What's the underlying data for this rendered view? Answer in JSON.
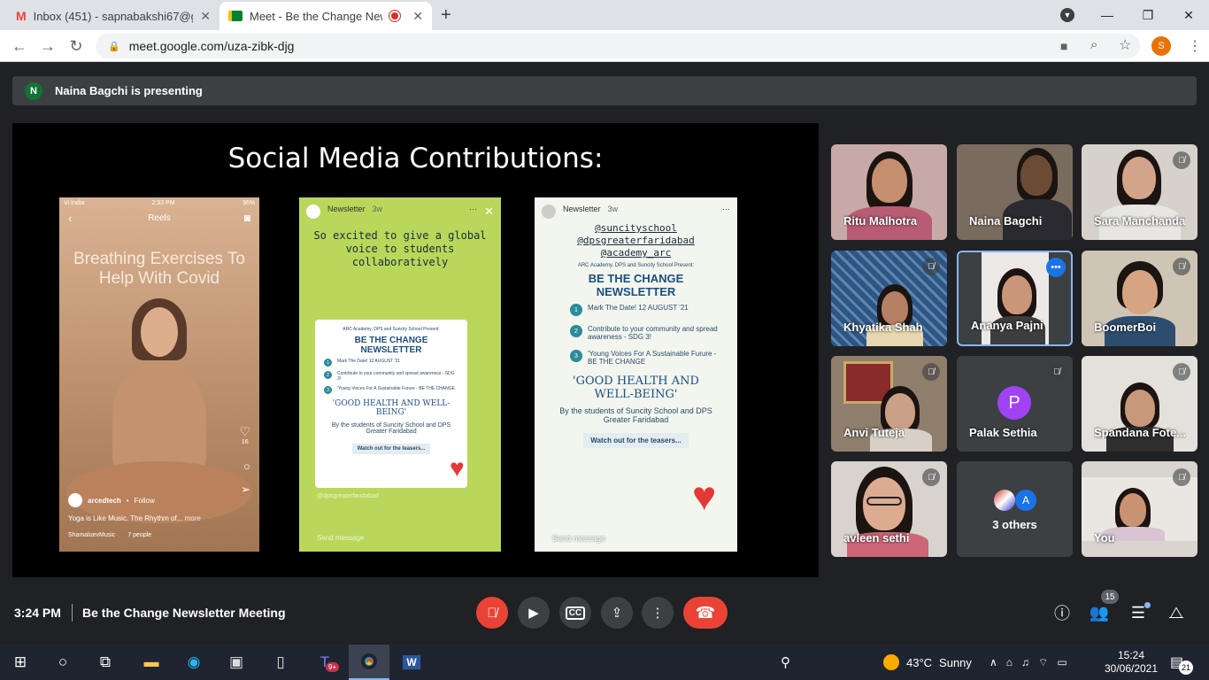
{
  "browser": {
    "tabs": [
      {
        "title": "Inbox (451) - sapnabakshi67@gm",
        "icon": "gmail-icon"
      },
      {
        "title": "Meet - Be the Change Newsl",
        "icon": "meet-icon"
      }
    ],
    "url": "meet.google.com/uza-zibk-djg",
    "profile_initial": "S",
    "profile_color": "#e8710a"
  },
  "meet": {
    "presenter_initial": "N",
    "presenting_text": "Naina Bagchi is presenting",
    "slide": {
      "title": "Social Media Contributions:",
      "reel": {
        "carrier": "Vi India",
        "time": "2:33 PM",
        "battery": "36%",
        "header": "Reels",
        "heading": "Breathing Exercises To Help With Covid",
        "likes": "16",
        "account": "arcedtech",
        "follow": "Follow",
        "caption": "Yoga is Like Music. The Rhythm of...",
        "more": "more",
        "music": "ShamaluevMusic",
        "people": "7 people"
      },
      "story1": {
        "account": "Newsletter",
        "age": "3w",
        "caption": "So excited to give a global voice to students collaboratively",
        "card_intro": "ARC Academy, DPS and Suncity School Present:",
        "card_title": "BE THE CHANGE NEWSLETTER",
        "items": [
          "Mark The Date! 12 AUGUST '21",
          "Contribute to your community and spread awareness - SDG 3!",
          "'Young Voices For A Sustainable Furure - BE THE CHANGE"
        ],
        "theme": "'GOOD HEALTH AND WELL-BEING'",
        "byline": "By the students of Suncity School and DPS Greater Faridabad",
        "button": "Watch out for the teasers...",
        "mention": "@dpsgreaterfaridabad",
        "reply": "Send message"
      },
      "story2": {
        "account": "Newsletter",
        "age": "3w",
        "mentions": [
          "@suncityschool",
          "@dpsgreaterfaridabad",
          "@academy_arc"
        ],
        "card_intro": "ARC Academy, DPS and Suncity School Present:",
        "card_title": "BE THE CHANGE NEWSLETTER",
        "items": [
          "Mark The Date! 12 AUGUST '21",
          "Contribute to your community and spread awareness - SDG 3!",
          "'Young Voices For A Sustainable Furure - BE THE CHANGE"
        ],
        "theme": "'GOOD HEALTH AND WELL-BEING'",
        "byline": "By the students of Suncity School and DPS Greater Faridabad",
        "button": "Watch out for the teasers...",
        "reply": "Send message"
      }
    },
    "participants": [
      {
        "name": "Ritu Malhotra",
        "muted": false
      },
      {
        "name": "Naina Bagchi",
        "muted": false
      },
      {
        "name": "Sara Manchanda",
        "muted": true
      },
      {
        "name": "Khyatika Shah",
        "muted": true
      },
      {
        "name": "Ananya Pajni",
        "muted": false
      },
      {
        "name": "BoomerBoi",
        "muted": true
      },
      {
        "name": "Anvi Tuteja",
        "muted": true
      },
      {
        "name": "Palak Sethia",
        "muted": true,
        "initial": "P",
        "color": "#a142f4"
      },
      {
        "name": "Spandana Fote...",
        "muted": true
      },
      {
        "name": "avleen sethi",
        "muted": true
      },
      {
        "name": "3 others",
        "initial": "A",
        "color": "#1a73e8"
      },
      {
        "name": "You",
        "muted": true
      }
    ],
    "time": "3:24 PM",
    "meeting_title": "Be the Change Newsletter Meeting",
    "people_count": "15",
    "colors": {
      "end_call": "#ea4335",
      "muted_mic": "#ea4335",
      "speaking": "#8ab4f8"
    }
  },
  "taskbar": {
    "weather_temp": "43°C",
    "weather_text": "Sunny",
    "clock_time": "15:24",
    "clock_date": "30/06/2021",
    "notifications": "21",
    "teams_badge": "9+"
  }
}
